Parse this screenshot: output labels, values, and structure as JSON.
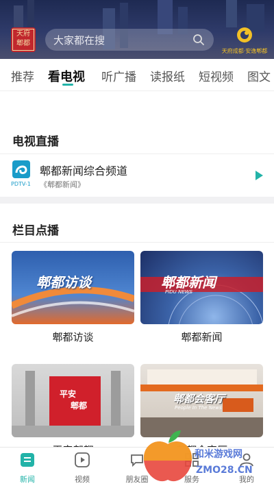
{
  "header": {
    "logo_text_line1": "天府",
    "logo_text_line2": "郫都",
    "search_placeholder": "大家都在搜",
    "brand_slogan": "天府成都·安逸郫都"
  },
  "tabs": [
    {
      "label": "推荐",
      "active": false
    },
    {
      "label": "看电视",
      "active": true
    },
    {
      "label": "听广播",
      "active": false
    },
    {
      "label": "读报纸",
      "active": false
    },
    {
      "label": "短视频",
      "active": false
    },
    {
      "label": "图文",
      "active": false
    }
  ],
  "live": {
    "section_title": "电视直播",
    "channel_code": "PDTV-1",
    "channel_name": "郫都新闻综合频道",
    "program": "《郫都新闻》"
  },
  "vod": {
    "section_title": "栏目点播",
    "programs": [
      {
        "label": "郫都访谈",
        "thumb_title": "郫都访谈"
      },
      {
        "label": "郫都新闻",
        "thumb_title": "郫都新闻",
        "thumb_sub": "PIDU NEWS"
      },
      {
        "label": "平安郫都",
        "thumb_title_line1": "平安",
        "thumb_title_line2": "郫都"
      },
      {
        "label": "郫都会客厅",
        "thumb_title": "郫都会客厅",
        "thumb_sub": "People In The News"
      }
    ]
  },
  "bottom_nav": [
    {
      "label": "新闻",
      "icon": "news-icon",
      "active": true
    },
    {
      "label": "视频",
      "icon": "video-play-icon",
      "active": false
    },
    {
      "label": "朋友圈",
      "icon": "chat-bubble-icon",
      "active": false
    },
    {
      "label": "服务",
      "icon": "service-icon",
      "active": false
    },
    {
      "label": "我的",
      "icon": "profile-icon",
      "active": false
    }
  ],
  "watermark": {
    "line1": "和米游戏网",
    "line2": "ZMO28.CN"
  },
  "colors": {
    "accent": "#22b3a8",
    "header_bg": "#2f3b6a",
    "logo_red": "#c1272d",
    "brand_gold": "#f2c026"
  }
}
